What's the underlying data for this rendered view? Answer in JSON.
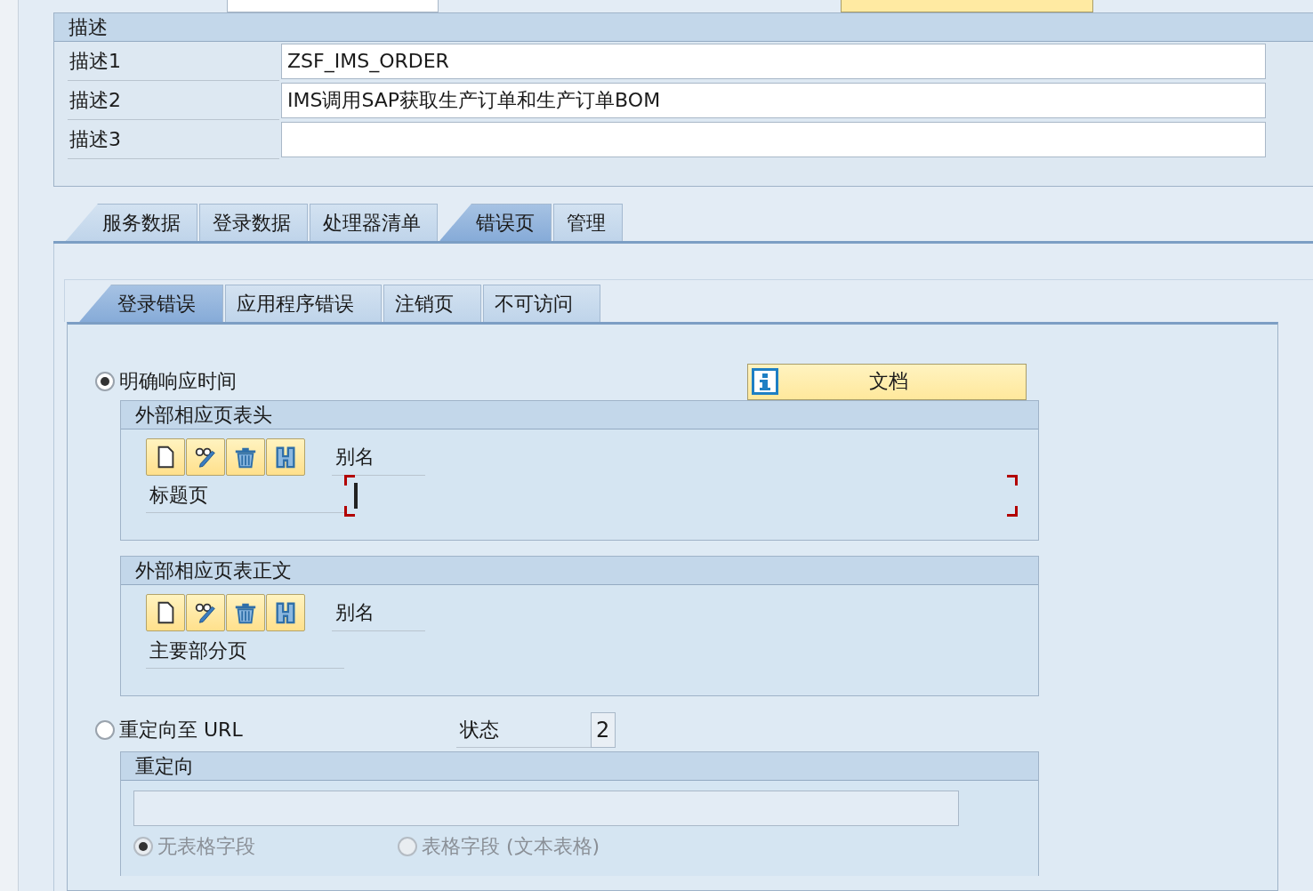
{
  "description_group": {
    "title": "描述",
    "rows": [
      {
        "label": "描述1",
        "value": "ZSF_IMS_ORDER"
      },
      {
        "label": "描述2",
        "value": "IMS调用SAP获取生产订单和生产订单BOM"
      },
      {
        "label": "描述3",
        "value": ""
      }
    ]
  },
  "tabs": [
    {
      "label": "服务数据",
      "selected": false
    },
    {
      "label": "登录数据",
      "selected": false
    },
    {
      "label": "处理器清单",
      "selected": false
    },
    {
      "label": "错误页",
      "selected": true
    },
    {
      "label": "管理",
      "selected": false
    }
  ],
  "subtabs": [
    {
      "label": "登录错误",
      "selected": true
    },
    {
      "label": "应用程序错误",
      "selected": false
    },
    {
      "label": "注销页",
      "selected": false
    },
    {
      "label": "不可访问",
      "selected": false
    }
  ],
  "response_modes": [
    {
      "label": "明确响应时间",
      "selected": true
    },
    {
      "label": "重定向至 URL",
      "selected": false
    }
  ],
  "doc_button": "文档",
  "page_groups": [
    {
      "title": "外部相应页表头",
      "alias_label": "别名",
      "page_label": "标题页",
      "focused": true
    },
    {
      "title": "外部相应页表正文",
      "alias_label": "别名",
      "page_label": "主要部分页",
      "focused": false
    }
  ],
  "status": {
    "label": "状态",
    "value": "2"
  },
  "redirect_group": {
    "title": "重定向",
    "options": [
      {
        "label": "无表格字段",
        "selected": true,
        "disabled": true
      },
      {
        "label": "表格字段 (文本表格)",
        "selected": false,
        "disabled": true
      }
    ]
  }
}
